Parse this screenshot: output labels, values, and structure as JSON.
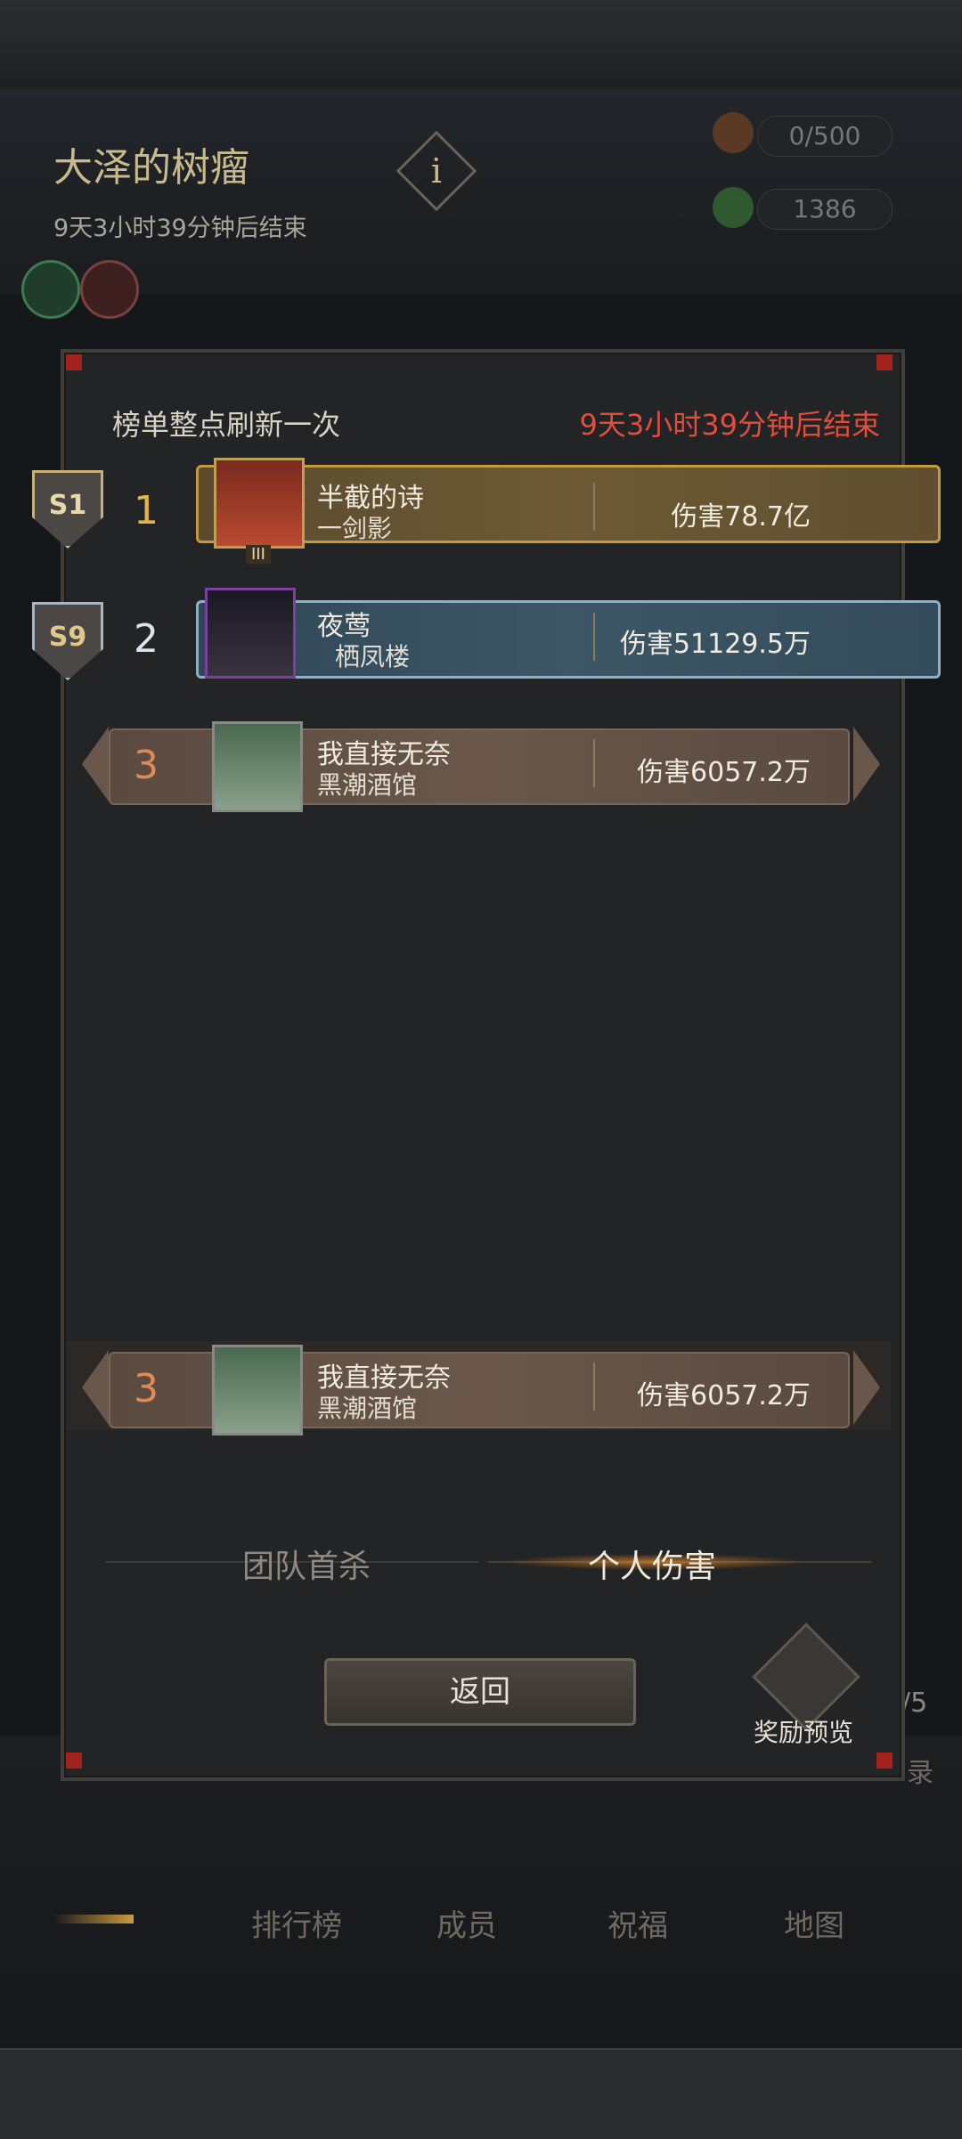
{
  "background": {
    "title": "大泽的树瘤",
    "subtitle": "9天3小时39分钟后结束",
    "info_glyph": "i",
    "resources": [
      {
        "icon": "drumstick-icon",
        "value": "0/500"
      },
      {
        "icon": "leaf-icon",
        "value": "1386"
      }
    ],
    "buffs": [
      "rune-shield-icon",
      "crossed-swords-icon"
    ],
    "page_indicator": "/5",
    "side_text": "录",
    "nav": [
      "排行榜",
      "成员",
      "祝福",
      "地图"
    ]
  },
  "panel": {
    "refresh_note": "榜单整点刷新一次",
    "countdown": "9天3小时39分钟后结束",
    "countdown_color": "#e24d3c",
    "rows": [
      {
        "season": "S1",
        "rank": "1",
        "name": "半截的诗",
        "guild": "一剑影",
        "damage": "伤害78.7亿",
        "tier": "gold",
        "avatar_badge": "III"
      },
      {
        "season": "S9",
        "rank": "2",
        "name": "夜莺",
        "guild": "栖凤楼",
        "damage": "伤害51129.5万",
        "tier": "silver"
      },
      {
        "rank": "3",
        "name": "我直接无奈",
        "guild": "黑潮酒馆",
        "damage": "伤害6057.2万",
        "tier": "bronze"
      }
    ],
    "self_row": {
      "rank": "3",
      "name": "我直接无奈",
      "guild": "黑潮酒馆",
      "damage": "伤害6057.2万"
    },
    "tabs": {
      "team_first_kill": "团队首杀",
      "personal_damage": "个人伤害",
      "active": "personal_damage"
    },
    "back_label": "返回",
    "reward_label": "奖励预览"
  }
}
